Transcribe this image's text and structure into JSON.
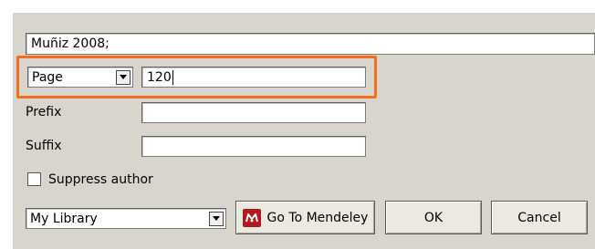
{
  "citation": {
    "value": "Muñiz 2008;"
  },
  "locator": {
    "type_selected": "Page",
    "value": "120"
  },
  "prefix": {
    "label": "Prefix",
    "value": ""
  },
  "suffix": {
    "label": "Suffix",
    "value": ""
  },
  "suppress_author": {
    "label": "Suppress author",
    "checked": false
  },
  "library": {
    "selected": "My Library"
  },
  "buttons": {
    "go_to_mendeley": "Go To Mendeley",
    "ok": "OK",
    "cancel": "Cancel"
  },
  "colors": {
    "highlight": "#f36f1f",
    "dialog_bg": "#d9d5cc",
    "mendeley_red": "#b11a1a"
  },
  "icons": [
    "chevron-down-icon",
    "mendeley-logo-icon"
  ]
}
